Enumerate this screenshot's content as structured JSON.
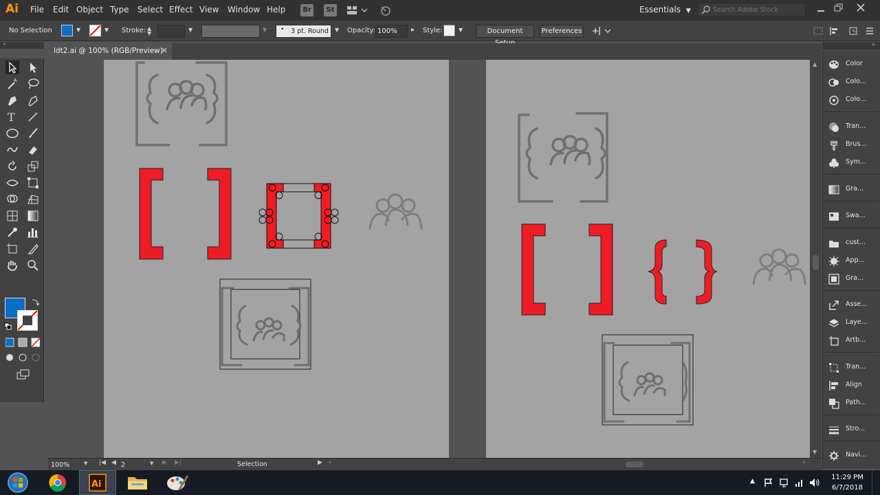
{
  "app": {
    "logo": "Ai",
    "workspace": "Essentials",
    "search_placeholder": "Search Adobe Stock",
    "bridge": "Br",
    "stock": "St"
  },
  "menu": [
    "File",
    "Edit",
    "Object",
    "Type",
    "Select",
    "Effect",
    "View",
    "Window",
    "Help"
  ],
  "control": {
    "selection": "No Selection",
    "stroke_label": "Stroke:",
    "brush": "3 pt. Round",
    "opacity_label": "Opacity:",
    "opacity_value": "100%",
    "style_label": "Style:",
    "doc_setup": "Document Setup",
    "preferences": "Preferences"
  },
  "document": {
    "tab_title": "ldt2.ai @ 100% (RGB/Preview)"
  },
  "status": {
    "zoom": "100%",
    "artboard": "2",
    "tool": "Selection"
  },
  "panels": [
    {
      "label": "Color",
      "icon": "palette-icon"
    },
    {
      "label": "Colo...",
      "icon": "color-guide-icon"
    },
    {
      "label": "Colo...",
      "icon": "color-themes-icon"
    },
    {
      "label": "Tran...",
      "icon": "transparency-icon"
    },
    {
      "label": "Brus...",
      "icon": "brush-icon"
    },
    {
      "label": "Sym...",
      "icon": "symbol-icon"
    },
    {
      "label": "Gra...",
      "icon": "gradient-icon"
    },
    {
      "label": "Swa...",
      "icon": "swatches-icon"
    },
    {
      "label": "cust...",
      "icon": "folder-icon"
    },
    {
      "label": "App...",
      "icon": "appearance-icon"
    },
    {
      "label": "Gra...",
      "icon": "graphic-styles-icon"
    },
    {
      "label": "Asse...",
      "icon": "export-icon"
    },
    {
      "label": "Laye...",
      "icon": "layers-icon"
    },
    {
      "label": "Artb...",
      "icon": "artboards-icon"
    },
    {
      "label": "Tran...",
      "icon": "transform-icon"
    },
    {
      "label": "Align",
      "icon": "align-icon"
    },
    {
      "label": "Path...",
      "icon": "pathfinder-icon"
    },
    {
      "label": "Stro...",
      "icon": "stroke-icon"
    },
    {
      "label": "Navi...",
      "icon": "navigator-icon"
    }
  ],
  "taskbar": {
    "time": "11:29 PM",
    "date": "6/7/2018"
  },
  "colors": {
    "accent_fill": "#0a6fc2",
    "shape_red": "#ee1c25",
    "app_orange": "#ff9a00"
  }
}
